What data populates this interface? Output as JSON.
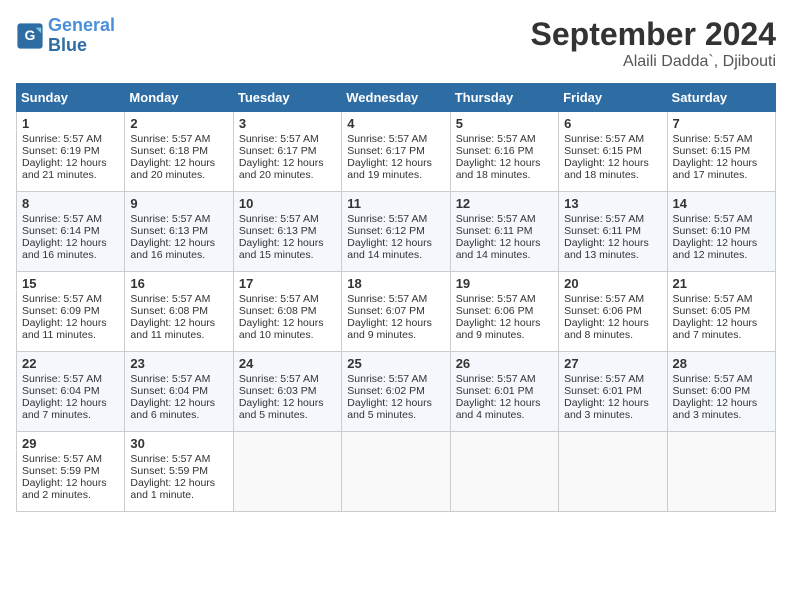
{
  "logo": {
    "line1": "General",
    "line2": "Blue"
  },
  "title": "September 2024",
  "subtitle": "Alaili Dadda`, Djibouti",
  "headers": [
    "Sunday",
    "Monday",
    "Tuesday",
    "Wednesday",
    "Thursday",
    "Friday",
    "Saturday"
  ],
  "weeks": [
    [
      {
        "day": "1",
        "sunrise": "5:57 AM",
        "sunset": "6:19 PM",
        "daylight": "12 hours and 21 minutes."
      },
      {
        "day": "2",
        "sunrise": "5:57 AM",
        "sunset": "6:18 PM",
        "daylight": "12 hours and 20 minutes."
      },
      {
        "day": "3",
        "sunrise": "5:57 AM",
        "sunset": "6:17 PM",
        "daylight": "12 hours and 20 minutes."
      },
      {
        "day": "4",
        "sunrise": "5:57 AM",
        "sunset": "6:17 PM",
        "daylight": "12 hours and 19 minutes."
      },
      {
        "day": "5",
        "sunrise": "5:57 AM",
        "sunset": "6:16 PM",
        "daylight": "12 hours and 18 minutes."
      },
      {
        "day": "6",
        "sunrise": "5:57 AM",
        "sunset": "6:15 PM",
        "daylight": "12 hours and 18 minutes."
      },
      {
        "day": "7",
        "sunrise": "5:57 AM",
        "sunset": "6:15 PM",
        "daylight": "12 hours and 17 minutes."
      }
    ],
    [
      {
        "day": "8",
        "sunrise": "5:57 AM",
        "sunset": "6:14 PM",
        "daylight": "12 hours and 16 minutes."
      },
      {
        "day": "9",
        "sunrise": "5:57 AM",
        "sunset": "6:13 PM",
        "daylight": "12 hours and 16 minutes."
      },
      {
        "day": "10",
        "sunrise": "5:57 AM",
        "sunset": "6:13 PM",
        "daylight": "12 hours and 15 minutes."
      },
      {
        "day": "11",
        "sunrise": "5:57 AM",
        "sunset": "6:12 PM",
        "daylight": "12 hours and 14 minutes."
      },
      {
        "day": "12",
        "sunrise": "5:57 AM",
        "sunset": "6:11 PM",
        "daylight": "12 hours and 14 minutes."
      },
      {
        "day": "13",
        "sunrise": "5:57 AM",
        "sunset": "6:11 PM",
        "daylight": "12 hours and 13 minutes."
      },
      {
        "day": "14",
        "sunrise": "5:57 AM",
        "sunset": "6:10 PM",
        "daylight": "12 hours and 12 minutes."
      }
    ],
    [
      {
        "day": "15",
        "sunrise": "5:57 AM",
        "sunset": "6:09 PM",
        "daylight": "12 hours and 11 minutes."
      },
      {
        "day": "16",
        "sunrise": "5:57 AM",
        "sunset": "6:08 PM",
        "daylight": "12 hours and 11 minutes."
      },
      {
        "day": "17",
        "sunrise": "5:57 AM",
        "sunset": "6:08 PM",
        "daylight": "12 hours and 10 minutes."
      },
      {
        "day": "18",
        "sunrise": "5:57 AM",
        "sunset": "6:07 PM",
        "daylight": "12 hours and 9 minutes."
      },
      {
        "day": "19",
        "sunrise": "5:57 AM",
        "sunset": "6:06 PM",
        "daylight": "12 hours and 9 minutes."
      },
      {
        "day": "20",
        "sunrise": "5:57 AM",
        "sunset": "6:06 PM",
        "daylight": "12 hours and 8 minutes."
      },
      {
        "day": "21",
        "sunrise": "5:57 AM",
        "sunset": "6:05 PM",
        "daylight": "12 hours and 7 minutes."
      }
    ],
    [
      {
        "day": "22",
        "sunrise": "5:57 AM",
        "sunset": "6:04 PM",
        "daylight": "12 hours and 7 minutes."
      },
      {
        "day": "23",
        "sunrise": "5:57 AM",
        "sunset": "6:04 PM",
        "daylight": "12 hours and 6 minutes."
      },
      {
        "day": "24",
        "sunrise": "5:57 AM",
        "sunset": "6:03 PM",
        "daylight": "12 hours and 5 minutes."
      },
      {
        "day": "25",
        "sunrise": "5:57 AM",
        "sunset": "6:02 PM",
        "daylight": "12 hours and 5 minutes."
      },
      {
        "day": "26",
        "sunrise": "5:57 AM",
        "sunset": "6:01 PM",
        "daylight": "12 hours and 4 minutes."
      },
      {
        "day": "27",
        "sunrise": "5:57 AM",
        "sunset": "6:01 PM",
        "daylight": "12 hours and 3 minutes."
      },
      {
        "day": "28",
        "sunrise": "5:57 AM",
        "sunset": "6:00 PM",
        "daylight": "12 hours and 3 minutes."
      }
    ],
    [
      {
        "day": "29",
        "sunrise": "5:57 AM",
        "sunset": "5:59 PM",
        "daylight": "12 hours and 2 minutes."
      },
      {
        "day": "30",
        "sunrise": "5:57 AM",
        "sunset": "5:59 PM",
        "daylight": "12 hours and 1 minute."
      },
      null,
      null,
      null,
      null,
      null
    ]
  ]
}
